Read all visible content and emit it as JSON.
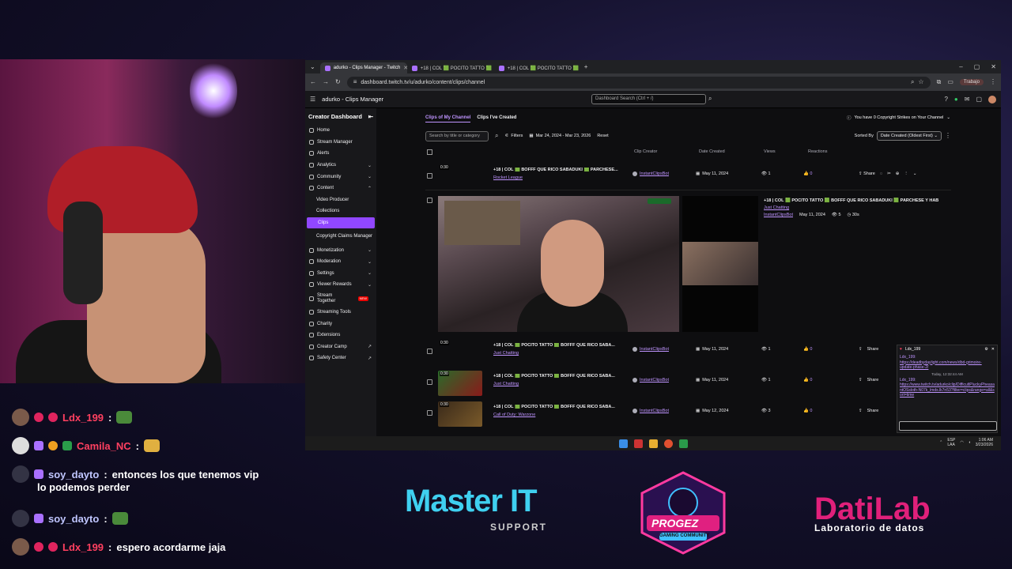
{
  "browser": {
    "tabs": [
      {
        "label": "adurko - Clips Manager - Twitch"
      },
      {
        "label": "+18 | COL 🟩 POCITO TATTO 🟩"
      },
      {
        "label": "+18 | COL 🟩 POCITO TATTO 🟩"
      }
    ],
    "url": "dashboard.twitch.tv/u/adurko/content/clips/channel",
    "profile": "Trabajo"
  },
  "header": {
    "title": "adurko - Clips Manager",
    "search_placeholder": "Dashboard Search (Ctrl + /)"
  },
  "sidebar": {
    "title": "Creator Dashboard",
    "items": [
      {
        "label": "Home"
      },
      {
        "label": "Stream Manager"
      },
      {
        "label": "Alerts"
      },
      {
        "label": "Analytics"
      },
      {
        "label": "Community"
      },
      {
        "label": "Content"
      },
      {
        "label": "Video Producer"
      },
      {
        "label": "Collections"
      },
      {
        "label": "Clips"
      },
      {
        "label": "Copyright Claims Manager"
      },
      {
        "label": "Monetization"
      },
      {
        "label": "Moderation"
      },
      {
        "label": "Settings"
      },
      {
        "label": "Viewer Rewards"
      },
      {
        "label": "Stream Together"
      },
      {
        "label": "Streaming Tools"
      },
      {
        "label": "Charity"
      },
      {
        "label": "Extensions"
      },
      {
        "label": "Creator Camp"
      },
      {
        "label": "Safety Center"
      }
    ],
    "new_badge": "NEW"
  },
  "main": {
    "tab_mine": "Clips of My Channel",
    "tab_created": "Clips I've Created",
    "strikes": "You have 0 Copyright Strikes on Your Channel",
    "search_placeholder": "Search by title or category",
    "filters": "Filters",
    "date_range": "Mar 24, 2024 - Mar 23, 2026",
    "reset": "Reset",
    "sorted_by": "Sorted By",
    "sort_value": "Date Created (Oldest First)",
    "columns": {
      "creator": "Clip Creator",
      "date": "Date Created",
      "views": "Views",
      "reactions": "Reactions"
    },
    "share": "Share",
    "rows": [
      {
        "dur": "0:30",
        "title": "+18 | COL 🟩 BOFFF QUE RICO SABADUKI 🟩 PARCHESE...",
        "category": "Rocket League",
        "creator": "InstantClipsBot",
        "date": "May 11, 2024",
        "views": "1",
        "reactions": "0"
      },
      {
        "dur": "0:30",
        "title": "+18 | COL 🟩 POCITO TATTO 🟩 BOFFF QUE RICO SABA...",
        "category": "Just Chatting",
        "creator": "InstantClipsBot",
        "date": "May 11, 2024",
        "views": "1",
        "reactions": "0"
      },
      {
        "dur": "0:30",
        "title": "+18 | COL 🟩 POCITO TATTO 🟩 BOFFF QUE RICO SABA...",
        "category": "Just Chatting",
        "creator": "InstantClipsBot",
        "date": "May 11, 2024",
        "views": "1",
        "reactions": "0"
      },
      {
        "dur": "0:30",
        "title": "+18 | COL 🟩 POCITO TATTO 🟩 BOFFF QUE RICO SABA...",
        "category": "Call of Duty: Warzone",
        "creator": "InstantClipsBot",
        "date": "May 12, 2024",
        "views": "3",
        "reactions": "0"
      }
    ],
    "preview": {
      "title": "+18 | COL 🟩 POCITO TATTO 🟩 BOFFF QUE RICO SABADUKI 🟩 PARCHESE Y HAB",
      "category": "Just Chatting",
      "creator": "InstantClipsBot",
      "date": "May 11, 2024",
      "views": "5",
      "duration": "30s"
    }
  },
  "popchat": {
    "user": "Ldx_199",
    "msg1_user": "Ldx_199:",
    "msg1": "https://deadbydaylight.com/news/dbd-grimoire-update-phase-2/",
    "time": "Today, 12:32:44 AM",
    "msg2_user": "Ldx_199:",
    "msg2": "https://www.twitch.tv/adurko/clip/DifficultPluckyPheasantOSsloth-N07k_lmds.lk7n53?filter=clips&range=all&sort=time"
  },
  "taskbar": {
    "lang1": "ESP",
    "lang2": "LAA",
    "time": "1:06 AM",
    "date": "3/23/2026"
  },
  "chat": [
    {
      "user": "Ldx_199",
      "sep": ":",
      "text": "",
      "user_color": "#ff4060"
    },
    {
      "user": "Camila_NC",
      "sep": ":",
      "text": "",
      "user_color": "#ff4060"
    },
    {
      "user": "soy_dayto",
      "sep": ":",
      "text": "entonces los que tenemos vip",
      "text2": "lo podemos perder",
      "user_color": "#c0c6ff"
    },
    {
      "user": "soy_dayto",
      "sep": ":",
      "text": "",
      "user_color": "#c0c6ff"
    },
    {
      "user": "Ldx_199",
      "sep": ":",
      "text": "espero acordarme jaja",
      "user_color": "#ff4060"
    }
  ],
  "sponsors": {
    "master_it": "Master IT",
    "master_it_sub": "SUPPORT",
    "progez": "PROGEZ",
    "progez_sub": "GAMING COMMUNITY",
    "datilab": "DatiLab",
    "datilab_sub": "Laboratorio de datos"
  }
}
